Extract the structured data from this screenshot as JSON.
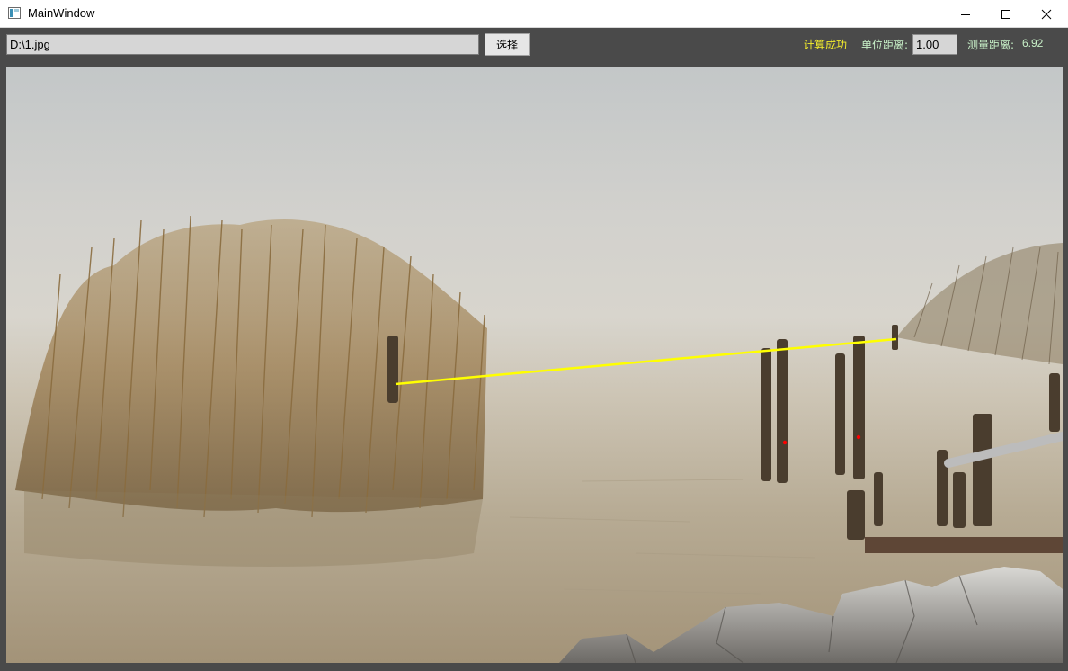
{
  "window": {
    "title": "MainWindow",
    "icon": "app-window-icon",
    "controls": [
      "minimize-icon",
      "maximize-icon",
      "close-icon"
    ]
  },
  "toolbar": {
    "file_path": "D:\\1.jpg",
    "select_label": "选择",
    "status": "计算成功",
    "unit_label": "单位距离:",
    "unit_value": "1.00",
    "measure_label": "测量距离:",
    "measure_value": "6.92"
  },
  "colors": {
    "status": "#f3ed2c",
    "labels": "#c8f0c8",
    "measure_line": "#ffff00",
    "marker": "#ff0000"
  }
}
